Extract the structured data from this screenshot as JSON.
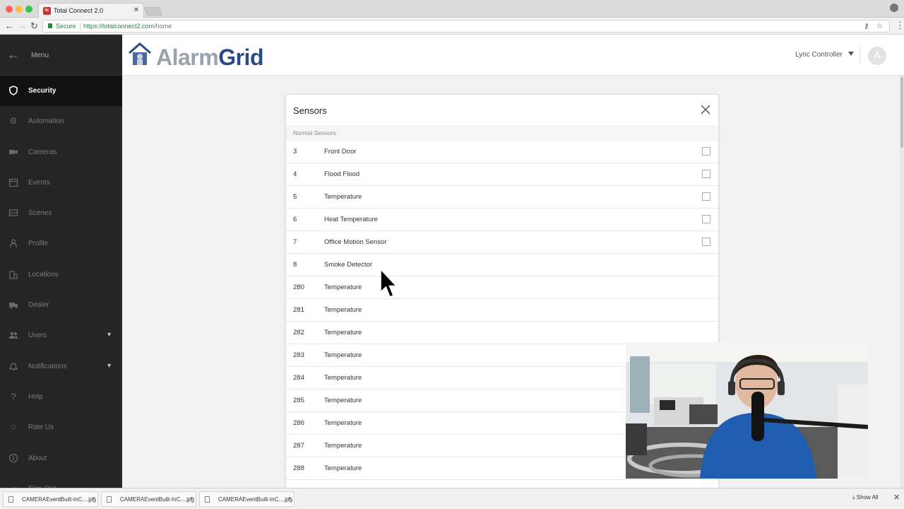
{
  "browser": {
    "tab_title": "Total Connect 2.0",
    "tab_favicon": "tc",
    "secure_label": "Secure",
    "url_host": "https://totalconnect2.com",
    "url_path": "/home"
  },
  "sidebar": {
    "menu_label": "Menu",
    "items": [
      {
        "label": "Security",
        "icon": "shield-icon",
        "active": true
      },
      {
        "label": "Automation",
        "icon": "automation-icon"
      },
      {
        "label": "Cameras",
        "icon": "camera-icon"
      },
      {
        "label": "Events",
        "icon": "calendar-icon"
      },
      {
        "label": "Scenes",
        "icon": "scenes-icon"
      },
      {
        "label": "Profile",
        "icon": "person-icon"
      },
      {
        "label": "Locations",
        "icon": "building-icon"
      },
      {
        "label": "Dealer",
        "icon": "truck-icon"
      },
      {
        "label": "Users",
        "icon": "users-icon",
        "expandable": true
      },
      {
        "label": "Notifications",
        "icon": "bell-icon",
        "expandable": true
      },
      {
        "label": "Help",
        "icon": "question-icon"
      },
      {
        "label": "Rate Us",
        "icon": "star-icon"
      },
      {
        "label": "About",
        "icon": "info-icon"
      },
      {
        "label": "Sign Out",
        "icon": "signout-icon"
      }
    ]
  },
  "header": {
    "logo_text_a": "Alarm",
    "logo_text_b": "Grid",
    "controller_label": "Lyric Controller",
    "avatar_letter": "A"
  },
  "modal": {
    "title": "Sensors",
    "section_label": "Normal Sensors",
    "rows": [
      {
        "num": "3",
        "name": "Front Door",
        "checkbox": true
      },
      {
        "num": "4",
        "name": "Flood Flood",
        "checkbox": true
      },
      {
        "num": "5",
        "name": "Temperature",
        "checkbox": true
      },
      {
        "num": "6",
        "name": "Heat Temperature",
        "checkbox": true
      },
      {
        "num": "7",
        "name": "Office Motion Sensor",
        "checkbox": true
      },
      {
        "num": "8",
        "name": "Smoke Detector",
        "checkbox": false
      },
      {
        "num": "280",
        "name": "Temperature",
        "checkbox": false
      },
      {
        "num": "281",
        "name": "Temperature",
        "checkbox": false
      },
      {
        "num": "282",
        "name": "Temperature",
        "checkbox": false
      },
      {
        "num": "283",
        "name": "Temperature",
        "checkbox": false
      },
      {
        "num": "284",
        "name": "Temperature",
        "checkbox": false
      },
      {
        "num": "285",
        "name": "Temperature",
        "checkbox": false
      },
      {
        "num": "286",
        "name": "Temperature",
        "checkbox": false
      },
      {
        "num": "287",
        "name": "Temperature",
        "checkbox": false
      },
      {
        "num": "288",
        "name": "Temperature",
        "checkbox": false
      }
    ]
  },
  "downloads": {
    "items": [
      "CAMERAEventBuilt-InC....jpg",
      "CAMERAEventBuilt-InC....jpg",
      "CAMERAEventBuilt-InC....jpg"
    ],
    "show_all_label": "Show All"
  },
  "colors": {
    "sidebar_bg": "#252525",
    "sidebar_active": "#111111",
    "logo_blue": "#2a4a86",
    "secure_green": "#1e8e3e"
  }
}
